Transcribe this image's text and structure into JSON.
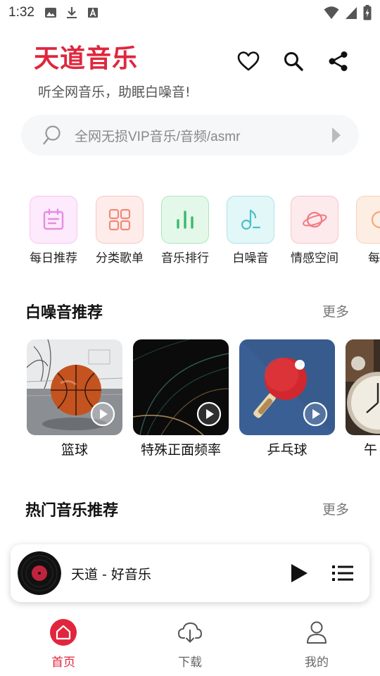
{
  "status_bar": {
    "time": "1:32"
  },
  "header": {
    "title": "天道音乐",
    "subtitle": "听全网音乐，助眠白噪音!"
  },
  "search": {
    "placeholder": "全网无损VIP音乐/音频/asmr"
  },
  "categories": [
    {
      "label": "每日推荐",
      "icon": "calendar-icon",
      "color": "#e48de0",
      "bg": "#fdeafc"
    },
    {
      "label": "分类歌单",
      "icon": "grid-icon",
      "color": "#f08a7a",
      "bg": "#fdecea"
    },
    {
      "label": "音乐排行",
      "icon": "bar-chart-icon",
      "color": "#3cb86a",
      "bg": "#e4f8e9"
    },
    {
      "label": "白噪音",
      "icon": "music-note-icon",
      "color": "#4ec0c8",
      "bg": "#e2f7f8"
    },
    {
      "label": "情感空间",
      "icon": "planet-icon",
      "color": "#f07a84",
      "bg": "#fdeaec"
    },
    {
      "label": "每日",
      "icon": "circle-icon",
      "color": "#f5a67a",
      "bg": "#fdeee4"
    }
  ],
  "white_noise": {
    "title": "白噪音推荐",
    "more": "更多",
    "items": [
      {
        "label": "篮球",
        "art": "basketball"
      },
      {
        "label": "特殊正面频率",
        "art": "abstract-lines"
      },
      {
        "label": "乒乓球",
        "art": "ping-pong"
      },
      {
        "label": "午",
        "art": "alarm-clock"
      }
    ]
  },
  "hot_music": {
    "title": "热门音乐推荐",
    "more": "更多"
  },
  "player": {
    "track": "天道 - 好音乐"
  },
  "nav": [
    {
      "label": "首页",
      "icon": "home-icon",
      "active": true
    },
    {
      "label": "下载",
      "icon": "cloud-download-icon",
      "active": false
    },
    {
      "label": "我的",
      "icon": "user-icon",
      "active": false
    }
  ],
  "colors": {
    "accent": "#e0263d"
  }
}
